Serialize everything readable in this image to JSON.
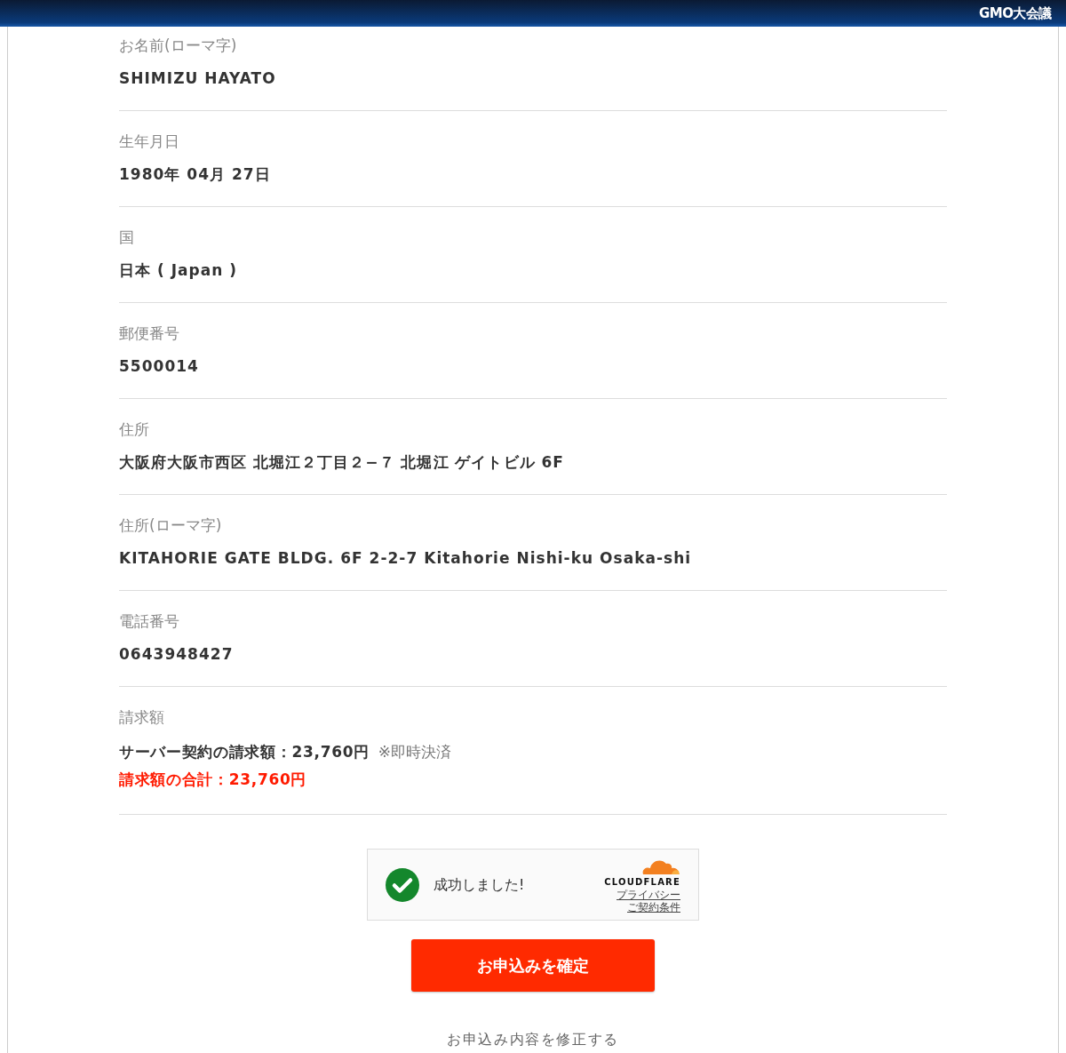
{
  "header": {
    "logo": "GMO大会議"
  },
  "fields": [
    {
      "label": "お名前(ローマ字)",
      "value": "SHIMIZU HAYATO"
    },
    {
      "label": "生年月日",
      "value": "1980年 04月 27日"
    },
    {
      "label": "国",
      "value": "日本 ( Japan )"
    },
    {
      "label": "郵便番号",
      "value": "5500014"
    },
    {
      "label": "住所",
      "value": "大阪府大阪市西区 北堀江２丁目２−７ 北堀江 ゲイトビル 6F"
    },
    {
      "label": "住所(ローマ字)",
      "value": "KITAHORIE GATE BLDG. 6F 2-2-7 Kitahorie Nishi-ku Osaka-shi"
    },
    {
      "label": "電話番号",
      "value": "0643948427"
    }
  ],
  "billing": {
    "label": "請求額",
    "line": "サーバー契約の請求額：23,760円",
    "note": "※即時決済",
    "total": "請求額の合計：23,760円"
  },
  "captcha": {
    "status": "成功しました!",
    "success": true,
    "brand": "CLOUDFLARE",
    "links": [
      "プライバシー",
      "ご契約条件"
    ]
  },
  "submit_button": "お申込みを確定",
  "edit_link": "お申込み内容を修正する"
}
